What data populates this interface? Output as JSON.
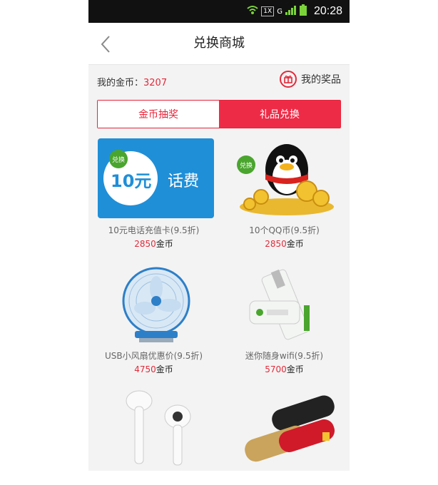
{
  "status_bar": {
    "time": "20:28",
    "network": "G",
    "box_label": "1X"
  },
  "header": {
    "title": "兑换商城"
  },
  "coins": {
    "label": "我的金币：",
    "value": "3207"
  },
  "my_prizes": {
    "label": "我的奖品"
  },
  "tabs": [
    {
      "label": "金币抽奖",
      "active": false
    },
    {
      "label": "礼品兑换",
      "active": true
    }
  ],
  "badge_text": "兑换",
  "coin_unit": "金币",
  "products": [
    {
      "name": "10元电话充值卡(9.5折)",
      "price": "2850",
      "image": "phone-card",
      "card_amount": "10元",
      "card_text": "话费"
    },
    {
      "name": "10个QQ币(9.5折)",
      "price": "2850",
      "image": "qq-penguin-coins"
    },
    {
      "name": "USB小风扇优惠价(9.5折)",
      "price": "4750",
      "image": "usb-fan"
    },
    {
      "name": "迷你随身wifi(9.5折)",
      "price": "5700",
      "image": "mini-wifi"
    },
    {
      "name": "",
      "price": "",
      "image": "earphones"
    },
    {
      "name": "",
      "price": "",
      "image": "power-banks"
    }
  ],
  "colors": {
    "accent": "#ee2b47",
    "price": "#e02b3a",
    "card_blue": "#1f8fd8",
    "badge_green": "#4aa52e"
  }
}
